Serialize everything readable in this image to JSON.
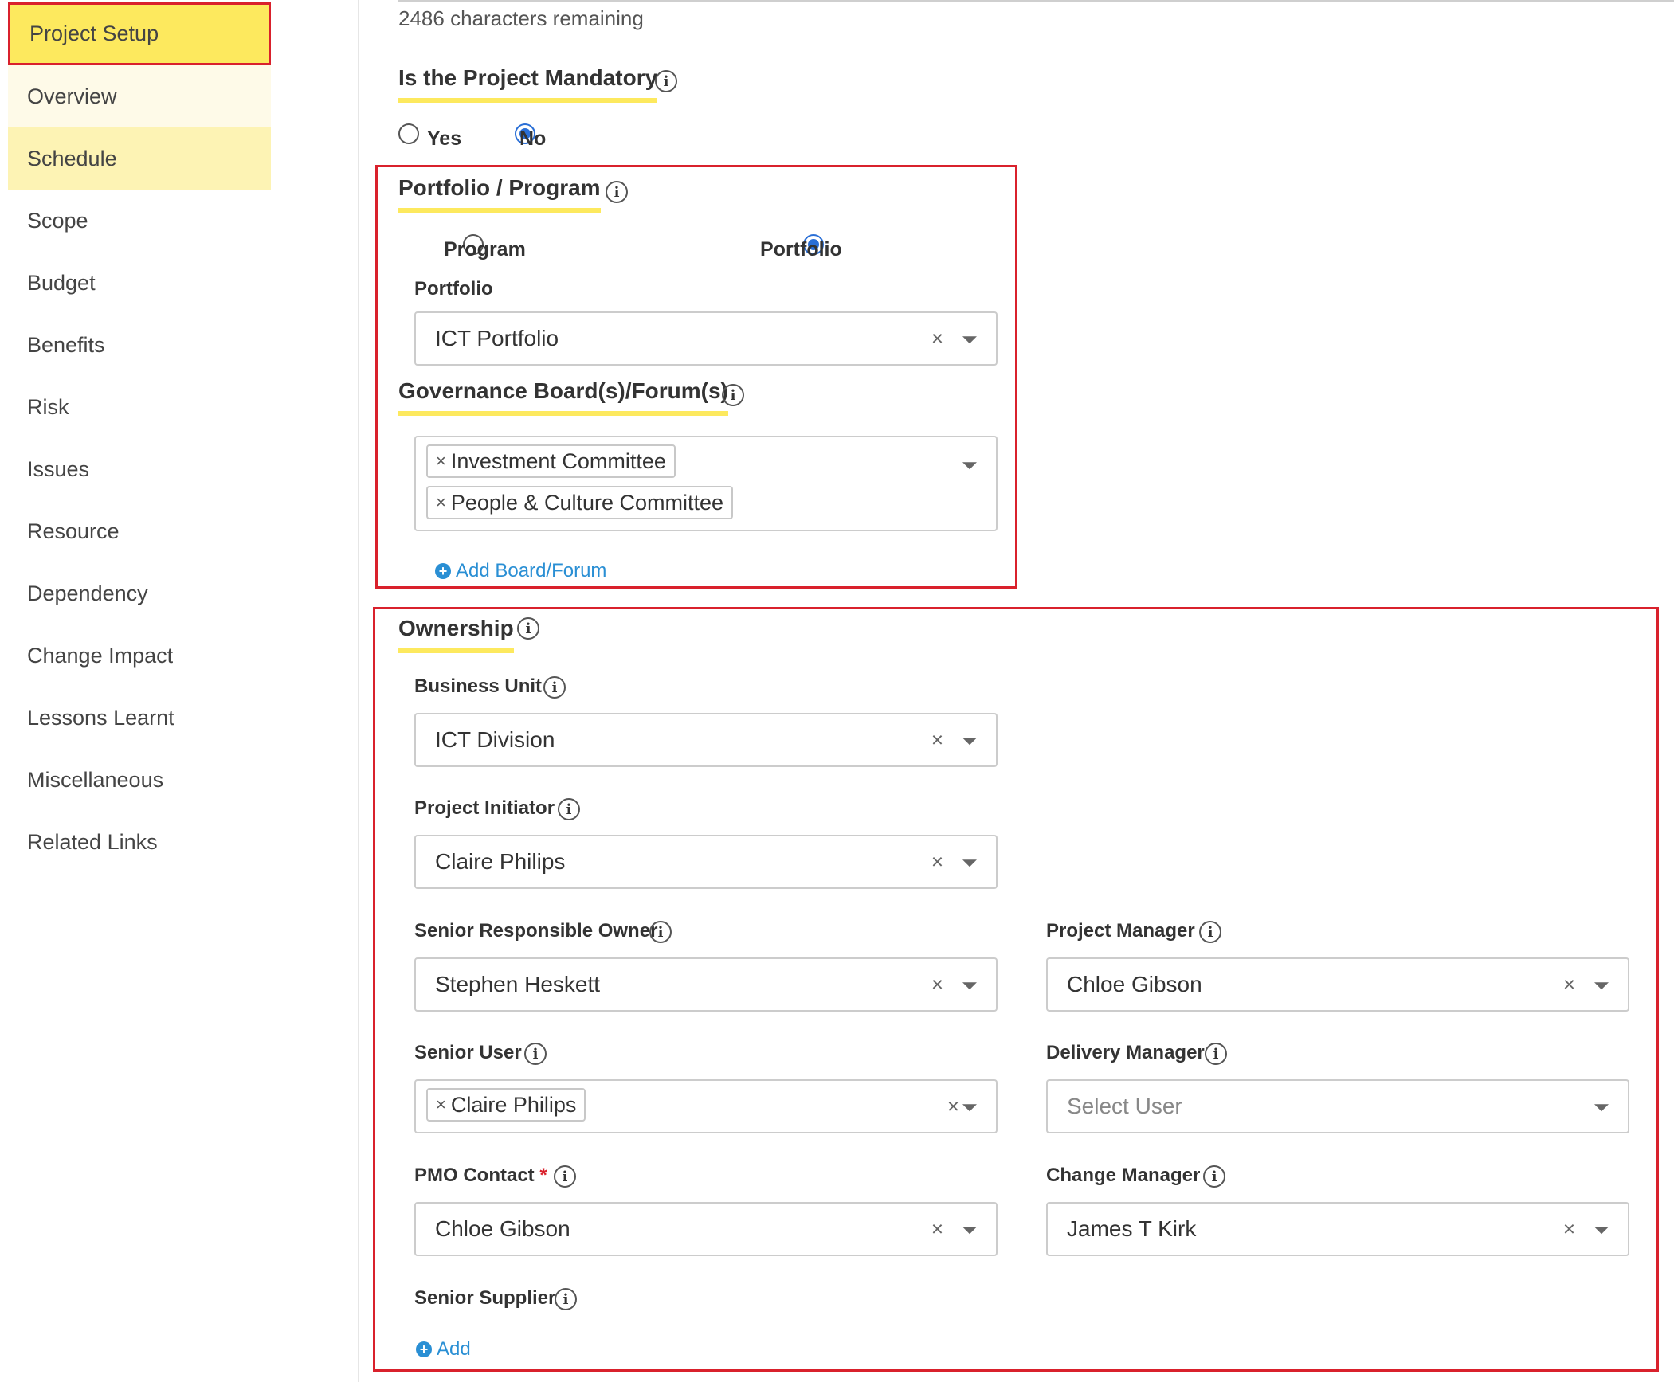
{
  "sidebar": {
    "items": [
      {
        "label": "Project Setup"
      },
      {
        "label": "Overview"
      },
      {
        "label": "Schedule"
      },
      {
        "label": "Scope"
      },
      {
        "label": "Budget"
      },
      {
        "label": "Benefits"
      },
      {
        "label": "Risk"
      },
      {
        "label": "Issues"
      },
      {
        "label": "Resource"
      },
      {
        "label": "Dependency"
      },
      {
        "label": "Change Impact"
      },
      {
        "label": "Lessons Learnt"
      },
      {
        "label": "Miscellaneous"
      },
      {
        "label": "Related Links"
      }
    ]
  },
  "description": {
    "chars_remaining": "2486 characters remaining"
  },
  "mandatory": {
    "title": "Is the Project Mandatory",
    "options": {
      "yes": "Yes",
      "no": "No"
    },
    "selected": "No"
  },
  "portfolio_program": {
    "title": "Portfolio / Program",
    "options": {
      "program": "Program",
      "portfolio": "Portfolio"
    },
    "selected": "Portfolio",
    "portfolio_label": "Portfolio",
    "portfolio_value": "ICT Portfolio",
    "clear_glyph": "×"
  },
  "governance": {
    "title": "Governance Board(s)/Forum(s)",
    "tags": [
      "Investment Committee",
      "People & Culture Committee"
    ],
    "remove_glyph": "×",
    "add_link": "Add Board/Forum"
  },
  "ownership": {
    "title": "Ownership",
    "clear_glyph": "×",
    "remove_glyph": "×",
    "business_unit": {
      "label": "Business Unit",
      "value": "ICT Division"
    },
    "project_initiator": {
      "label": "Project Initiator",
      "value": "Claire Philips"
    },
    "senior_responsible_owner": {
      "label": "Senior Responsible Owner",
      "value": "Stephen Heskett"
    },
    "project_manager": {
      "label": "Project Manager",
      "value": "Chloe Gibson"
    },
    "senior_user": {
      "label": "Senior User",
      "tags": [
        "Claire Philips"
      ]
    },
    "delivery_manager": {
      "label": "Delivery Manager",
      "placeholder": "Select User"
    },
    "pmo_contact": {
      "label": "PMO Contact",
      "required_mark": "*",
      "value": "Chloe Gibson"
    },
    "change_manager": {
      "label": "Change Manager",
      "value": "James T Kirk"
    },
    "senior_supplier": {
      "label": "Senior Supplier",
      "add_link": "Add"
    }
  },
  "icons": {
    "info": "i",
    "plus": "+"
  },
  "colors": {
    "accent_yellow": "#fde95e",
    "highlight_red": "#d9212c",
    "link_blue": "#2a8fd4",
    "radio_blue": "#2a6fd6"
  }
}
